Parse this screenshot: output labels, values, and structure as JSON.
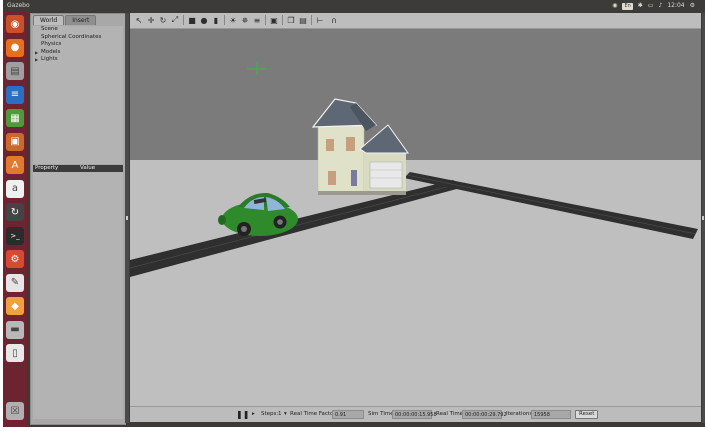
{
  "app": {
    "title": "Gazebo"
  },
  "system_tray": {
    "keyboard": "En",
    "clock": "12:04"
  },
  "launcher": {
    "items": [
      {
        "name": "dash-home-icon",
        "color": "#c9512a"
      },
      {
        "name": "firefox-icon",
        "color": "#e56f1d"
      },
      {
        "name": "files-icon",
        "color": "#a0a0a0"
      },
      {
        "name": "writer-icon",
        "color": "#2a6fc2"
      },
      {
        "name": "calc-icon",
        "color": "#4f9a3d"
      },
      {
        "name": "impress-icon",
        "color": "#c9692a"
      },
      {
        "name": "software-center-icon",
        "color": "#e07b2e"
      },
      {
        "name": "amazon-icon",
        "color": "#f0f0f0"
      },
      {
        "name": "updater-icon",
        "color": "#444444"
      },
      {
        "name": "terminal-icon",
        "color": "#2b2b2b"
      },
      {
        "name": "settings-icon",
        "color": "#d44b33"
      },
      {
        "name": "text-editor-icon",
        "color": "#e5e5e5"
      },
      {
        "name": "gazebo-icon",
        "color": "#f0a040"
      },
      {
        "name": "disks-icon",
        "color": "#b8b8b8"
      },
      {
        "name": "usb-drive-icon",
        "color": "#e8e8e8"
      },
      {
        "name": "trash-icon",
        "color": "#b0b0b0"
      }
    ]
  },
  "world_panel": {
    "tabs": [
      {
        "label": "World",
        "active": true
      },
      {
        "label": "Insert",
        "active": false
      }
    ],
    "tree": [
      {
        "label": "Scene",
        "expandable": false
      },
      {
        "label": "Spherical Coordinates",
        "expandable": false
      },
      {
        "label": "Physics",
        "expandable": false
      },
      {
        "label": "Models",
        "expandable": true
      },
      {
        "label": "Lights",
        "expandable": true
      }
    ],
    "properties": {
      "col_property": "Property",
      "col_value": "Value"
    }
  },
  "toolbar": {
    "tools": [
      "select-arrow-icon",
      "translate-icon",
      "rotate-icon",
      "scale-icon",
      "box-shape-icon",
      "sphere-shape-icon",
      "cylinder-shape-icon",
      "point-light-icon",
      "spot-light-icon",
      "directional-light-icon",
      "screenshot-icon",
      "copy-icon",
      "paste-icon",
      "align-icon",
      "snap-icon"
    ]
  },
  "bottom_bar": {
    "steps_label": "Steps:",
    "steps_value": "1",
    "rtf_label": "Real Time Factor:",
    "rtf_value": "0.91",
    "sim_time_label": "Sim Time:",
    "sim_time_value": "00:00:00:15.958",
    "real_time_label": "Real Time:",
    "real_time_value": "00:00:00:29.792",
    "iterations_label": "Iterations:",
    "iterations_value": "15958",
    "reset_label": "Reset"
  },
  "colors": {
    "ground": "#bfbfbf",
    "sky": "#7b7b7b",
    "road": "#2f2f2f",
    "car": "#2f8a2c",
    "house_siding": "#dfe2c8",
    "house_roof": "#5d6874"
  }
}
